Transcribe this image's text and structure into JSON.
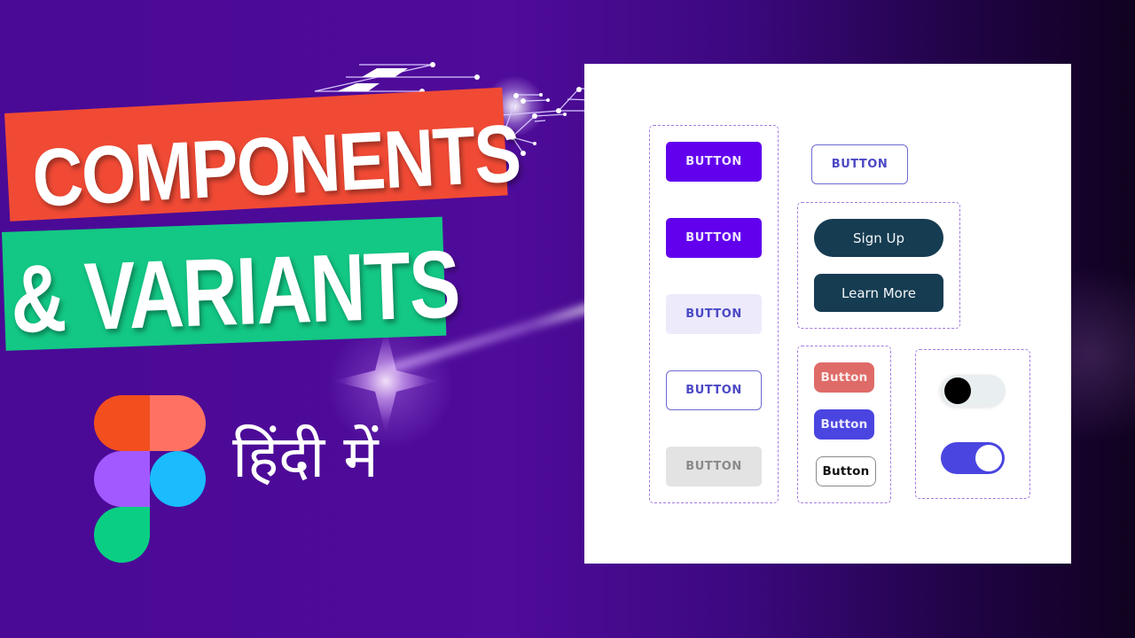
{
  "title": {
    "line1": "COMPONENTS",
    "line2": "& VARIANTS",
    "banner1_color": "#f04a35",
    "banner2_color": "#13c784"
  },
  "subtitle": "हिंदी में",
  "logo": {
    "name": "figma-logo",
    "colors": [
      "#f24e1e",
      "#ff7262",
      "#a259ff",
      "#1abcfe",
      "#0acf83"
    ]
  },
  "card": {
    "group_primary": {
      "buttons": [
        {
          "label": "BUTTON",
          "variant": "contained"
        },
        {
          "label": "BUTTON",
          "variant": "contained"
        },
        {
          "label": "BUTTON",
          "variant": "tonal"
        },
        {
          "label": "BUTTON",
          "variant": "outlined"
        },
        {
          "label": "BUTTON",
          "variant": "disabled"
        }
      ]
    },
    "standalone_button": {
      "label": "BUTTON",
      "variant": "outlined"
    },
    "group_dark": {
      "buttons": [
        {
          "label": "Sign Up",
          "shape": "pill"
        },
        {
          "label": "Learn More",
          "shape": "rounded"
        }
      ]
    },
    "group_small": {
      "buttons": [
        {
          "label": "Button",
          "color": "#de6b67"
        },
        {
          "label": "Button",
          "color": "#4a45e0"
        },
        {
          "label": "Button",
          "color": "#ffffff"
        }
      ]
    },
    "group_toggles": {
      "toggles": [
        {
          "state": "off"
        },
        {
          "state": "on",
          "color": "#4a45e0"
        }
      ]
    }
  }
}
